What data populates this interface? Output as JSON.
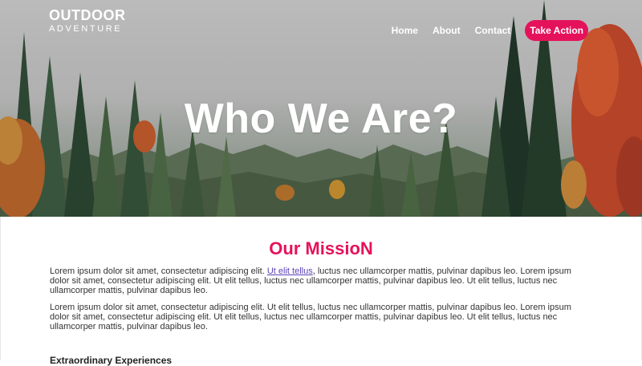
{
  "logo": {
    "line1": "OUTDOOR",
    "line2": "ADVENTURE"
  },
  "nav": {
    "home": "Home",
    "about": "About",
    "contact": "Contact",
    "cta": "Take Action"
  },
  "hero": {
    "title": "Who We Are?"
  },
  "mission": {
    "title": "Our MissioN",
    "p1_before": "Lorem ipsum dolor sit amet, consectetur adipiscing elit. ",
    "p1_link": "Ut elit tellus",
    "p1_after": ", luctus nec ullamcorper mattis, pulvinar dapibus leo. Lorem ipsum dolor sit amet, consectetur adipiscing elit. Ut elit tellus, luctus nec ullamcorper mattis, pulvinar dapibus leo. Ut elit tellus, luctus nec ullamcorper mattis, pulvinar dapibus leo.",
    "p2": "Lorem ipsum dolor sit amet, consectetur adipiscing elit. Ut elit tellus, luctus nec ullamcorper mattis, pulvinar dapibus leo. Lorem ipsum dolor sit amet, consectetur adipiscing elit. Ut elit tellus, luctus nec ullamcorper mattis, pulvinar dapibus leo. Ut elit tellus, luctus nec ullamcorper mattis, pulvinar dapibus leo.",
    "subheading": "Extraordinary Experiences"
  },
  "colors": {
    "accent": "#e5125b",
    "link": "#5b3fb5"
  }
}
